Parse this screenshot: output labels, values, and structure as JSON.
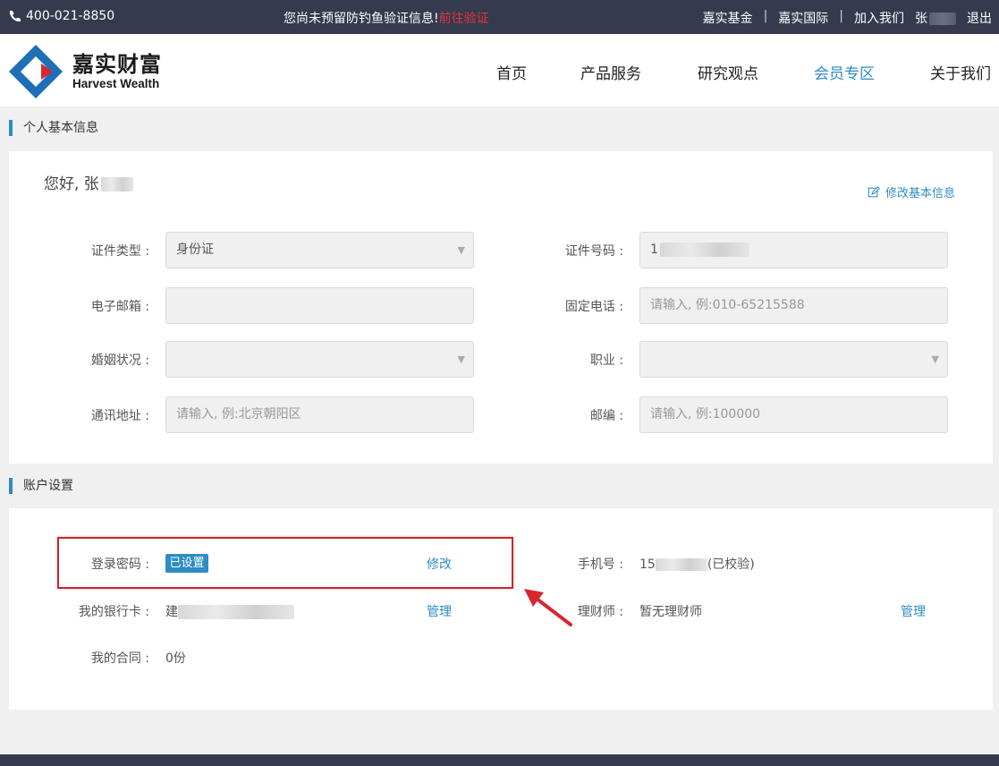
{
  "topbar": {
    "phone": "400-021-8850",
    "notice": "您尚未预留防钓鱼验证信息!",
    "verify_link": "前往验证",
    "links": [
      "嘉实基金",
      "嘉实国际",
      "加入我们"
    ],
    "separator": "|",
    "user": "张",
    "logout": "退出"
  },
  "logo": {
    "cn": "嘉实财富",
    "en": "Harvest Wealth"
  },
  "nav": {
    "items": [
      "首页",
      "产品服务",
      "研究观点",
      "会员专区",
      "关于我们"
    ],
    "active_index": 3
  },
  "basic_info": {
    "section_title": "个人基本信息",
    "greeting": "您好, 张",
    "edit_link": "修改基本信息",
    "fields": {
      "id_type": {
        "label": "证件类型 :",
        "value": "身份证"
      },
      "id_number": {
        "label": "证件号码 :",
        "value": "1"
      },
      "email": {
        "label": "电子邮箱 :",
        "value": ""
      },
      "landline": {
        "label": "固定电话 :",
        "placeholder": "请输入, 例:010-65215588"
      },
      "marital": {
        "label": "婚姻状况 :",
        "value": ""
      },
      "occupation": {
        "label": "职业 :",
        "value": ""
      },
      "address": {
        "label": "通讯地址 :",
        "placeholder": "请输入, 例:北京朝阳区"
      },
      "postcode": {
        "label": "邮编 :",
        "placeholder": "请输入, 例:100000"
      }
    }
  },
  "account": {
    "section_title": "账户设置",
    "password": {
      "label": "登录密码 :",
      "status": "已设置",
      "action": "修改"
    },
    "phone": {
      "label": "手机号 :",
      "prefix": "15",
      "suffix": "(已校验)"
    },
    "bank_card": {
      "label": "我的银行卡 :",
      "prefix": "建",
      "action": "管理"
    },
    "advisor": {
      "label": "理财师 :",
      "value": "暂无理财师",
      "action": "管理"
    },
    "contract": {
      "label": "我的合同 :",
      "value": "0份"
    }
  },
  "colors": {
    "accent": "#2d8dc4",
    "topbar": "#363a4e",
    "alert": "#e0353b",
    "highlight": "#c8252b"
  }
}
